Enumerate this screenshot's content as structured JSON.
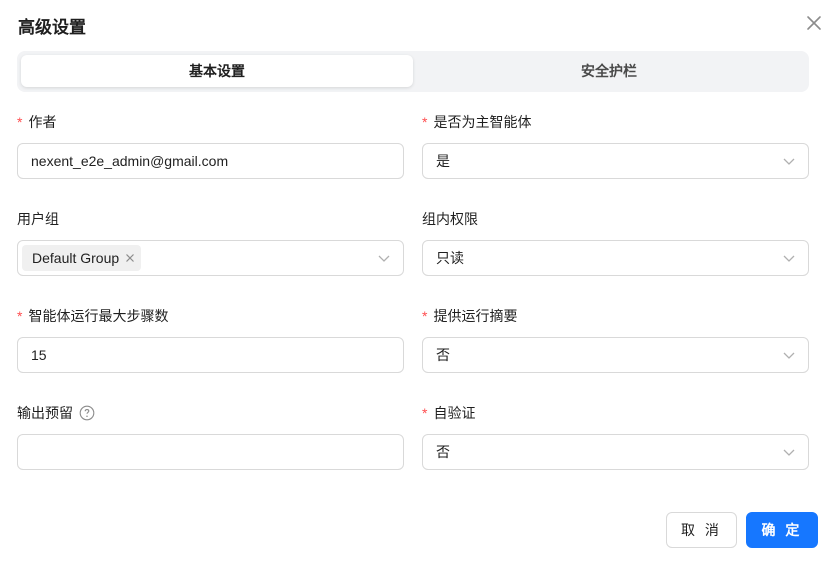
{
  "dialog": {
    "title": "高级设置",
    "close_icon": "close-icon"
  },
  "tabs": [
    {
      "label": "基本设置",
      "active": true
    },
    {
      "label": "安全护栏",
      "active": false
    }
  ],
  "fields": {
    "author": {
      "label": "作者",
      "required": true,
      "value": "nexent_e2e_admin@gmail.com"
    },
    "is_main_agent": {
      "label": "是否为主智能体",
      "required": true,
      "value": "是"
    },
    "user_group": {
      "label": "用户组",
      "required": false,
      "tags": [
        "Default Group"
      ]
    },
    "group_permission": {
      "label": "组内权限",
      "required": false,
      "value": "只读"
    },
    "max_steps": {
      "label": "智能体运行最大步骤数",
      "required": true,
      "value": "15"
    },
    "provide_summary": {
      "label": "提供运行摘要",
      "required": true,
      "value": "否"
    },
    "output_reserve": {
      "label": "输出预留",
      "required": false,
      "value": "",
      "help_icon": "question-circle-icon"
    },
    "self_verify": {
      "label": "自验证",
      "required": true,
      "value": "否"
    }
  },
  "footer": {
    "cancel_label": "取 消",
    "ok_label": "确 定"
  },
  "colors": {
    "primary": "#1677ff",
    "required": "#ff4d4f",
    "border": "#d9d9d9",
    "tab_bg": "#f2f3f5"
  },
  "required_mark": "*"
}
